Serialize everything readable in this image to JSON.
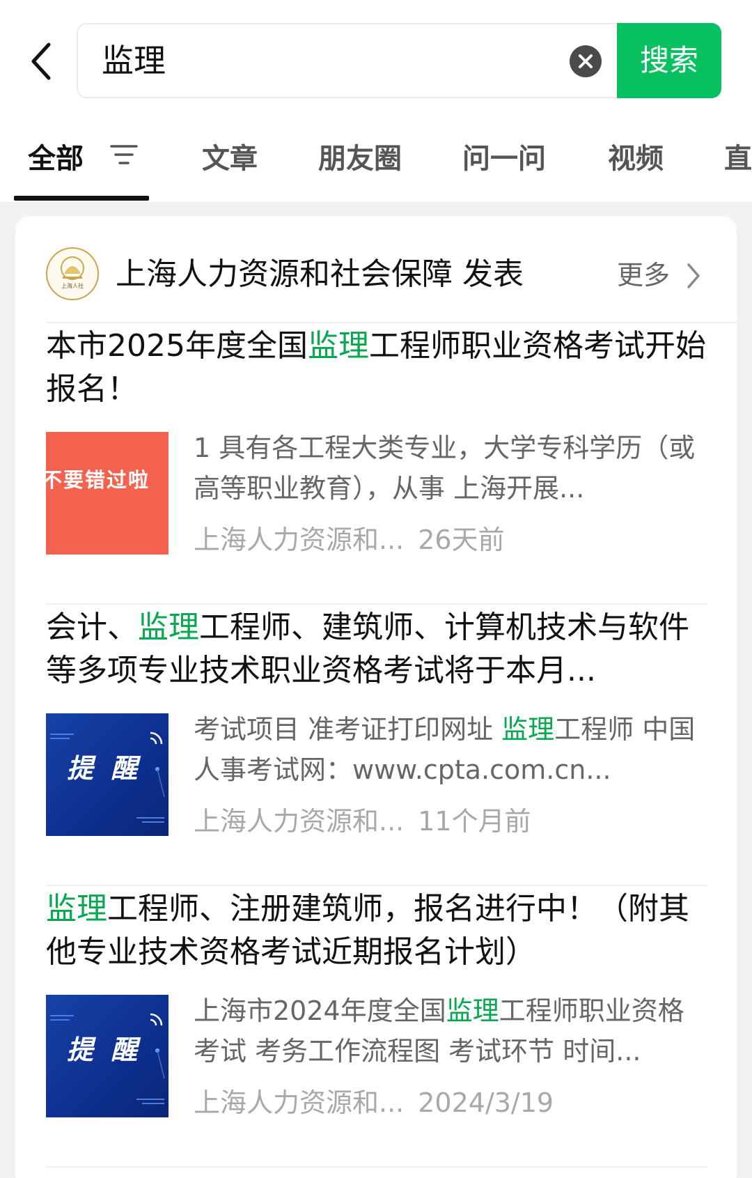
{
  "search": {
    "query": "监理",
    "button_label": "搜索"
  },
  "tabs": [
    {
      "label": "全部",
      "active": true
    },
    {
      "label": "文章"
    },
    {
      "label": "朋友圈"
    },
    {
      "label": "问一问"
    },
    {
      "label": "视频"
    },
    {
      "label": "直"
    }
  ],
  "source": {
    "name": "上海人力资源和社会保障 发表",
    "more_label": "更多",
    "logo_text": "上海人社"
  },
  "articles": [
    {
      "title_pre": "本市2025年度全国",
      "title_hl": "监理",
      "title_post": "工程师职业资格考试开始报名！",
      "thumb_text": "不要错过啦",
      "snippet_pre": "1 具有各工程大类专业，大学专科学历（或高等职业教育），从事 上海开展...",
      "snippet_hl": "",
      "snippet_post": "",
      "author": "上海人力资源和...",
      "date": "26天前"
    },
    {
      "title_pre": "会计、",
      "title_hl": "监理",
      "title_post": "工程师、建筑师、计算机技术与软件等多项专业技术职业资格考试将于本月...",
      "thumb_text": "提 醒",
      "snippet_pre": "考试项目 准考证打印网址 ",
      "snippet_hl": "监理",
      "snippet_post": "工程师 中国人事考试网：www.cpta.com.cn...",
      "author": "上海人力资源和...",
      "date": "11个月前"
    },
    {
      "title_pre": "",
      "title_hl": "监理",
      "title_post": "工程师、注册建筑师，报名进行中！（附其他专业技术资格考试近期报名计划）",
      "thumb_text": "提 醒",
      "snippet_pre": "上海市2024年度全国",
      "snippet_hl": "监理",
      "snippet_post": "工程师职业资格考试 考务工作流程图 考试环节 时间...",
      "author": "上海人力资源和...",
      "date": "2024/3/19"
    }
  ],
  "colors": {
    "accent": "#07c160",
    "highlight": "#07a84f"
  }
}
